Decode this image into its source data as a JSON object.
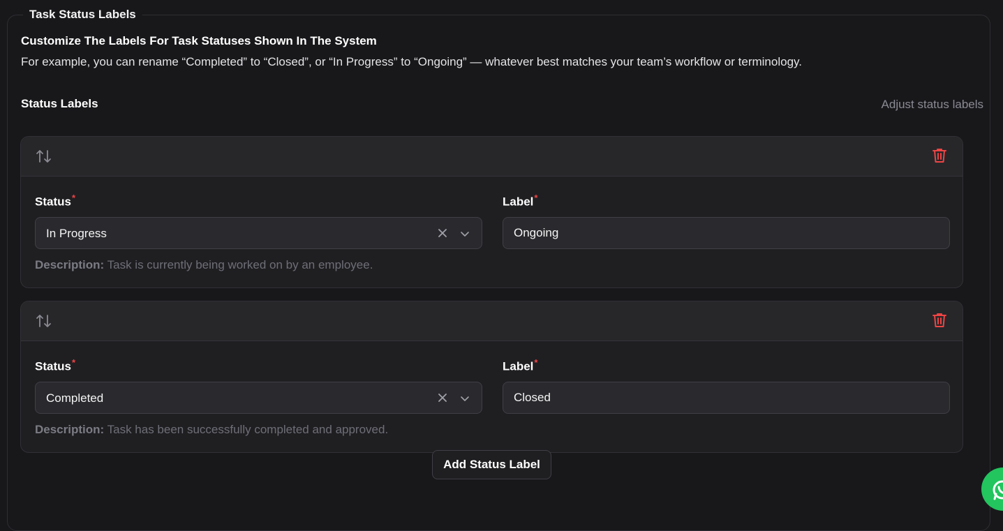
{
  "section": {
    "legend": "Task Status Labels",
    "intro_title": "Customize The Labels For Task Statuses Shown In The System",
    "intro_text": "For example, you can rename “Completed” to “Closed”, or “In Progress” to “Ongoing” — whatever best matches your team’s workflow or terminology."
  },
  "list": {
    "title": "Status Labels",
    "hint": "Adjust status labels",
    "items": [
      {
        "status_label": "Status",
        "status_value": "In Progress",
        "label_label": "Label",
        "label_value": "Ongoing",
        "desc_prefix": "Description:",
        "desc_text": "Task is currently being worked on by an employee."
      },
      {
        "status_label": "Status",
        "status_value": "Completed",
        "label_label": "Label",
        "label_value": "Closed",
        "desc_prefix": "Description:",
        "desc_text": "Task has been successfully completed and approved."
      }
    ],
    "required_mark": "*"
  },
  "add_button_label": "Add Status Label",
  "icons": {
    "sort": "sort-arrows-icon",
    "delete": "trash-icon",
    "clear": "close-icon",
    "dropdown": "chevron-down-icon",
    "chat": "whatsapp-icon"
  },
  "colors": {
    "danger": "#ef4444",
    "chat": "#22c55e"
  }
}
